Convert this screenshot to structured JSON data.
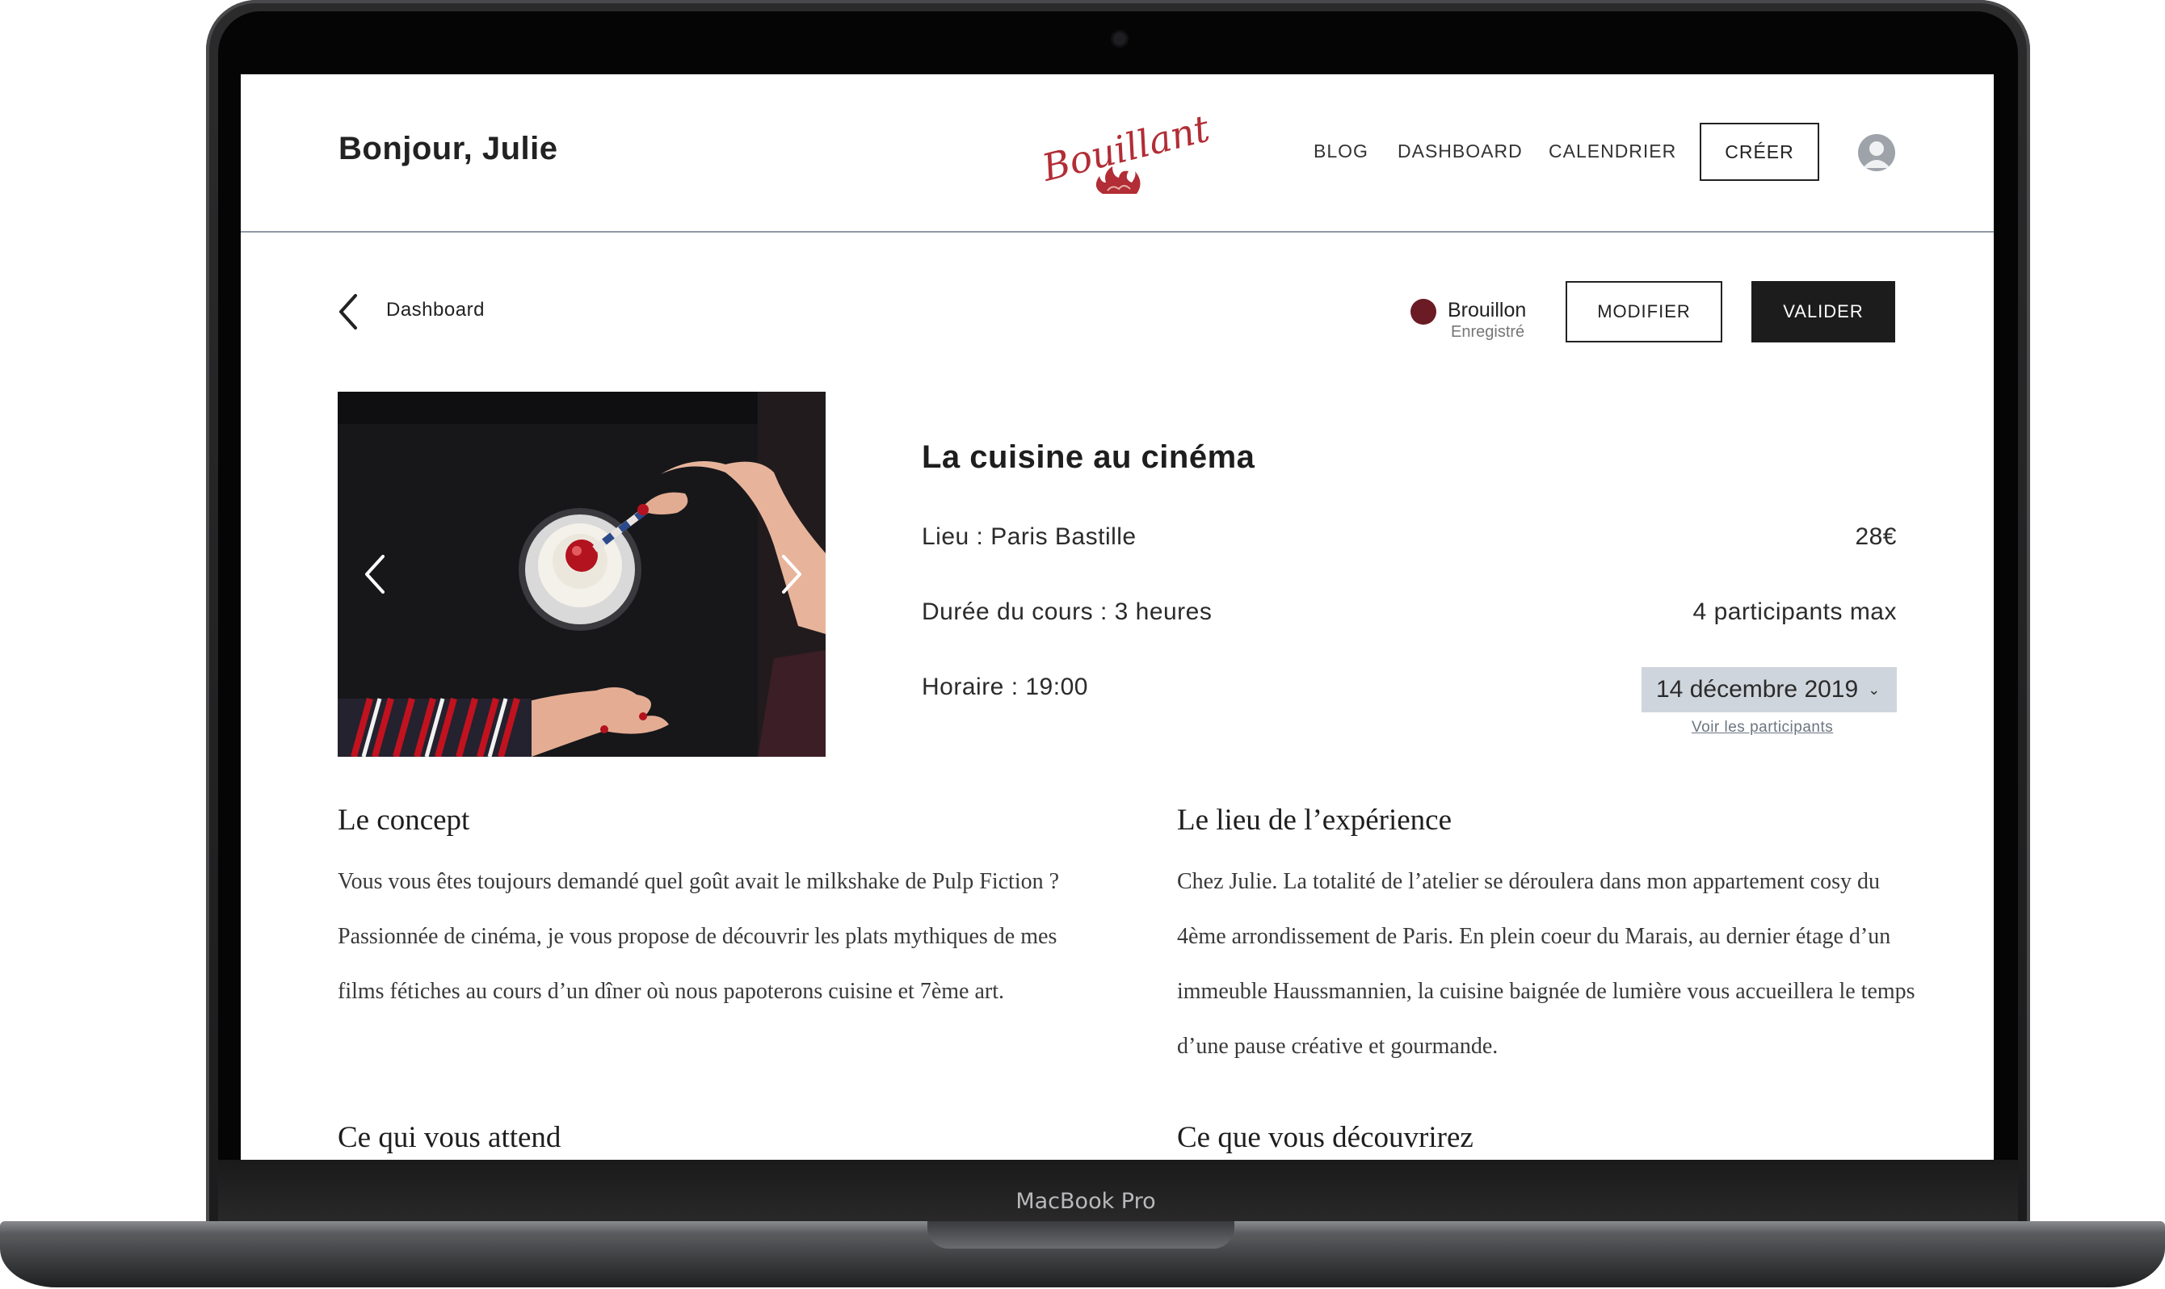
{
  "device": {
    "model_label": "MacBook Pro"
  },
  "header": {
    "greeting": "Bonjour, Julie",
    "logo_text": "Bouillant!",
    "nav": [
      "BLOG",
      "DASHBOARD",
      "CALENDRIER"
    ],
    "create_label": "CRÉER"
  },
  "breadcrumb": {
    "label": "Dashboard"
  },
  "status": {
    "label": "Brouillon",
    "sub": "Enregistré",
    "color": "#6a1b24",
    "modify_label": "MODIFIER",
    "validate_label": "VALIDER"
  },
  "course": {
    "title": "La cuisine au cinéma",
    "lieu": "Lieu : Paris Bastille",
    "price": "28€",
    "duree": "Durée du cours : 3 heures",
    "participants": "4 participants max",
    "horaire": "Horaire : 19:00",
    "date": "14 décembre 2019",
    "participants_link": "Voir les participants"
  },
  "sections": {
    "concept_title": "Le concept",
    "concept_text": "Vous vous êtes toujours demandé quel goût avait le milkshake de Pulp Fiction ? Passionnée de cinéma, je vous propose de découvrir les plats mythiques de mes films fétiches au cours d’un dîner où nous papoterons cuisine et 7ème art.",
    "lieu_title": "Le lieu de l’expérience",
    "lieu_text": "Chez Julie. La totalité de l’atelier se déroulera dans mon appartement cosy du 4ème arrondissement de Paris. En plein coeur du Marais, au dernier étage d’un immeuble Haussmannien, la cuisine baignée de lumière vous accueillera le temps d’une pause créative et gourmande.",
    "attend_title": "Ce qui vous attend",
    "decouvrirez_title": "Ce que vous découvrirez"
  },
  "colors": {
    "accent": "#c0392b",
    "dark_button": "#1c1c1c",
    "select_bg": "#cfd5dc"
  }
}
